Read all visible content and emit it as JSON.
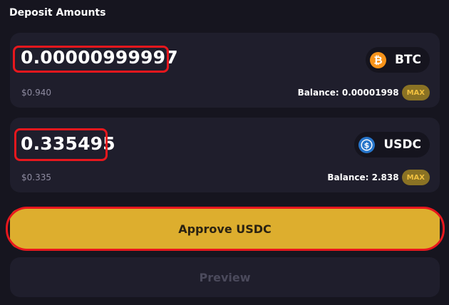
{
  "section": {
    "title": "Deposit Amounts"
  },
  "inputs": [
    {
      "amount": "0.00000999997",
      "usd_value": "$0.940",
      "token": "BTC",
      "token_icon": "bitcoin-icon",
      "balance_label": "Balance: 0.00001998",
      "max_label": "MAX"
    },
    {
      "amount": "0.335495",
      "usd_value": "$0.335",
      "token": "USDC",
      "token_icon": "usdc-icon",
      "balance_label": "Balance: 2.838",
      "max_label": "MAX"
    }
  ],
  "buttons": {
    "approve": "Approve USDC",
    "preview": "Preview"
  },
  "colors": {
    "background": "#16151f",
    "card": "#1f1e2c",
    "accent": "#ddae2e",
    "highlight": "#e8171d",
    "btc": "#f7931a",
    "usdc": "#2775ca"
  }
}
